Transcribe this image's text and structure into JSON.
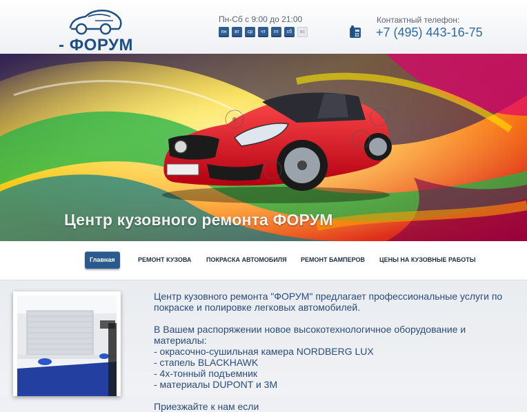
{
  "header": {
    "logo_text": "- ФОРУМ -",
    "hours_text": "Пн-Сб с 9:00 до 21:00",
    "days": [
      "пн",
      "вт",
      "ср",
      "чт",
      "пт",
      "сб",
      "вс"
    ],
    "phone_label": "Контактный телефон:",
    "phone_number": "+7 (495) 443-16-75"
  },
  "banner": {
    "title": "Центр кузовного ремонта ФОРУМ"
  },
  "nav": {
    "items": [
      {
        "label": "Главная",
        "active": true
      },
      {
        "label": "РЕМОНТ КУЗОВА"
      },
      {
        "label": "ПОКРАСКА АВТОМОБИЛЯ"
      },
      {
        "label": "РЕМОНТ БАМПЕРОВ"
      },
      {
        "label": "ЦЕНЫ НА КУЗОВНЫЕ РАБОТЫ"
      }
    ]
  },
  "content": {
    "intro": "Центр кузовного ремонта \"ФОРУМ\" предлагает профессиональные услуги по покраске и полировке легковых автомобилей.",
    "equipment_heading": "В Вашем распоряжении новое высокотехнологичное оборудование и материалы:",
    "equipment": [
      "- окрасочно-сушильная камера NORDBERG LUX",
      "- стапель BLACKHAWK",
      "- 4х-тонный подъемник",
      "- материалы DUPONT и 3M"
    ],
    "invite": "Приезжайте к нам если"
  },
  "colors": {
    "brand": "#1e4f82",
    "nav_active": "#2b5a8f",
    "text": "#2a4a7a"
  }
}
